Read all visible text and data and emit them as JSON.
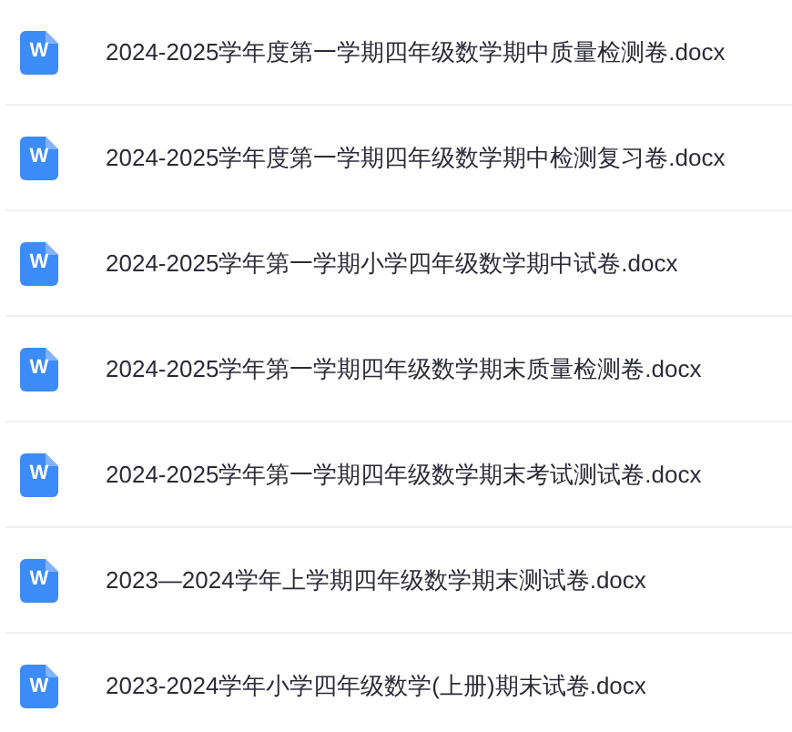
{
  "files": [
    {
      "icon_label": "W",
      "name": "2024-2025学年度第一学期四年级数学期中质量检测卷.docx"
    },
    {
      "icon_label": "W",
      "name": "2024-2025学年度第一学期四年级数学期中检测复习卷.docx"
    },
    {
      "icon_label": "W",
      "name": "2024-2025学年第一学期小学四年级数学期中试卷.docx"
    },
    {
      "icon_label": "W",
      "name": "2024-2025学年第一学期四年级数学期末质量检测卷.docx"
    },
    {
      "icon_label": "W",
      "name": "2024-2025学年第一学期四年级数学期末考试测试卷.docx"
    },
    {
      "icon_label": "W",
      "name": "2023—2024学年上学期四年级数学期末测试卷.docx"
    },
    {
      "icon_label": "W",
      "name": "2023-2024学年小学四年级数学(上册)期末试卷.docx"
    }
  ]
}
